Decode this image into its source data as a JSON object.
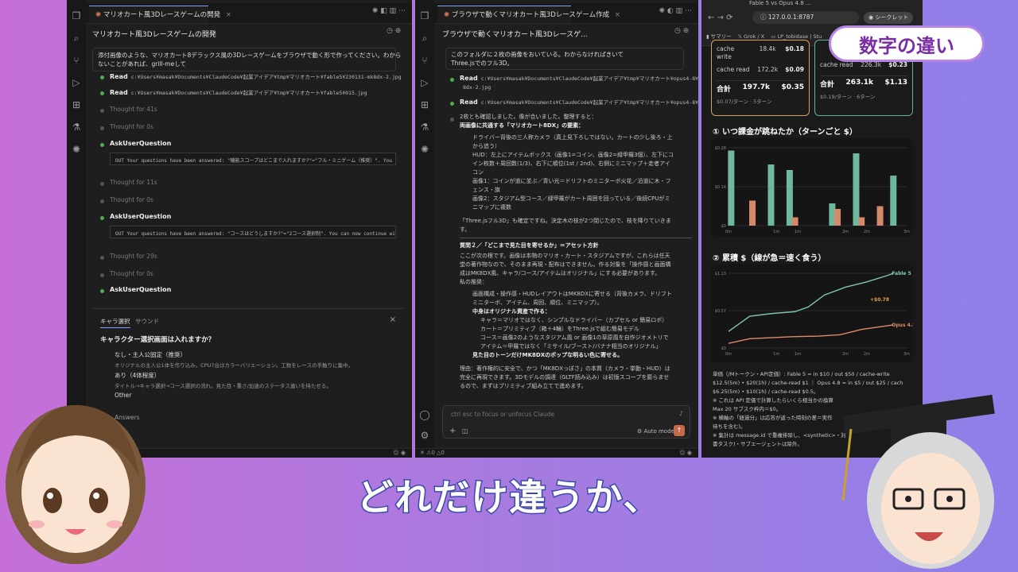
{
  "left_win": {
    "tab_title": "マリオカート風3Dレースゲームの開発",
    "header": "マリオカート風3Dレースゲームの開発",
    "prompt_line1": "添付画像のような、マリオカート8デラックス風の3Dレースゲームをブラウザで動く形で作ってください。わから",
    "prompt_line2": "ないことがあれば、grill-meして",
    "read1_label": "Read",
    "read1_path": "c:¥Users¥masak¥Documents¥ClaudeCode¥起業アイデア¥tmp¥マリオカート¥fable5¥230131-mk8dx-2.jpg",
    "read2_label": "Read",
    "read2_path": "c:¥Users¥masak¥Documents¥ClaudeCode¥起業アイデア¥tmp¥マリオカート¥fable5¥015.jpg",
    "thought1": "Thought for 41s",
    "thought2": "Thought for 0s",
    "ask1": "AskUserQuestion",
    "answer1": "OUT  Your questions have been answered: \"機能スコープはどこまで入れますか?\"=\"フル・ミニゲーム（推奨）\". You can",
    "thought3": "Thought for 11s",
    "thought4": "Thought for 0s",
    "ask2": "AskUserQuestion",
    "answer2": "OUT  Your questions have been answered: \"コースはどうしますか?\"=\"2コース選択制\". You can now continue with the",
    "thought5": "Thought for 29s",
    "thought6": "Thought for 0s",
    "ask3": "AskUserQuestion",
    "q_tab1": "キャラ選択",
    "q_tab2": "サウンド",
    "question": "キャラクター選択画面は入れますか？",
    "opt1_title": "なし・主人公固定（推奨）",
    "opt1_desc": "オリジナルの主人公1体を作り込み。CPU7台はカラーバリエーション。工数をレースの手触りに集中。",
    "opt2_title": "あり（4体程度）",
    "opt2_desc": "タイトル→キャラ選択→コース選択の流れ。見た目・重さ/加速のステータス違いを持たせる。",
    "opt3_title": "Other",
    "submit": "Answers"
  },
  "mid_win": {
    "tab_title": "ブラウザで動くマリオカート風3Dレースゲーム作成",
    "header": "ブラウザで動くマリオカート風3Dレースゲ...",
    "msg1": "このフォルダに２枚の画像をおいている。わからなければきいて",
    "msg2": "Three.jsでのフル3D。",
    "read1_label": "Read",
    "read1_path": "c:¥Users¥masak¥Documents¥ClaudeCode¥起業アイデア¥tmp¥マリオカート¥opus4-8¥230131-mk",
    "read1_path2": "8dx-2.jpg",
    "read2_label": "Read",
    "read2_path": "c:¥Users¥masak¥Documents¥ClaudeCode¥起業アイデア¥tmp¥マリオカート¥opus4-8¥015.jpg",
    "p1": "2枚とも確認しました。像が合いました。整理すると：",
    "p2": "両画像に共通する「マリオカート8DX」の要素：",
    "b1": "ドライバー背後の三人称カメラ（真上見下ろしではない。カートの少し後ろ・上",
    "b1b": "から追う）",
    "b2": "HUD：左上にアイテムボックス（画像1=コイン、画像2=緑甲羅3個）、左下にコ",
    "b2b": "イン枚数＋周回数(1/3)、右下に順位(1st / 2nd)、右側にミニマップ＋走者アイ",
    "b2c": "コン",
    "b3": "画像1：コインが道に並ぶ／青い光＝ドリフトのミニターボ火花／沿道に木・フ",
    "b3b": "ェンス・旗",
    "b4": "画像2：スタジアム型コース／緑甲羅がカート周囲を回っている／後続CPUがミ",
    "b4b": "ニマップに複数",
    "p3": "「Three.jsフル3D」も確定ですね。決定木の枝が2つ閉じたので、枝を降りていきま",
    "p3b": "す。",
    "q2": "質問２／「どこまで見た目を寄せるか」＝アセット方針",
    "p4": "ここが次の根です。画像は本物のマリオ・カート・スタジアムですが、これらは任天",
    "p4b": "堂の著作物なので、そのまま再現・配布はできません。作る対象を「操作感と画面構",
    "p4c": "成はMK8DX風、キャラ/コース/アイテムはオリジナル」にする必要があります。",
    "p5": "私の推奨：",
    "c1": "画面構成・操作感・HUDレイアウトはMK8DXに寄せる（背後カメラ、ドリフト",
    "c1b": "ミニターボ、アイテム、周回、順位、ミニマップ）。",
    "c2": "中身はオリジナル資産で作る：",
    "c3": "キャラ＝マリオではなく、シンプルなドライバー（カプセル or 簡易ロボ）",
    "c4": "カート＝プリミティブ（箱＋4輪）をThree.jsで組む簡易モデル",
    "c5": "コース＝画像2のようなスタジアム風 or 画像1の草原風を自作ジオメトリで",
    "c6": "アイテム＝甲羅ではなく「ミサイル/ブースト/バナナ相当のオリジナル」",
    "c7": "見た目のトーンだけMK8DXのポップな明るい色に寄せる。",
    "p6": "理由：著作権的に安全で、かつ「MK8DXっぽさ」の本質（カメラ・挙動・HUD）は",
    "p6b": "完全に再現できます。3Dモデルの調達（GLTF読み込み）は初版スコープを膨らませ",
    "p6c": "るので、まずはプリミティブ組み立てで進めます。",
    "input_placeholder": "ctrl esc to focus or unfocus Claude",
    "mode": "Auto mode"
  },
  "browser": {
    "tab1": "Fable 5 vs Opus 4.8 ...",
    "url": "127.0.0.1:8787",
    "profile": "シークレット",
    "bm1": "サマリー",
    "bm2": "Grok / X",
    "bm3": "LP_tobidase | Stu",
    "left_card": {
      "rows": [
        {
          "label": "cache write",
          "tok": "18.4k",
          "usd": "$0.18"
        },
        {
          "label": "cache read",
          "tok": "172.2k",
          "usd": "$0.09"
        }
      ],
      "total_label": "合計",
      "total_tok": "197.7k",
      "total_usd": "$0.35",
      "foot": "$0.07/ターン · 5ターン"
    },
    "right_card": {
      "rows": [
        {
          "label": "cache read",
          "tok": "226.3k",
          "usd": "$0.23"
        }
      ],
      "total_label": "合計",
      "total_tok": "263.1k",
      "total_usd": "$1.13",
      "foot": "$0.19/ターン · 6ターン"
    },
    "sec1": "① いつ課金が跳ねたか（ターンごと $）",
    "sec2": "② 累積 $（線が急＝速く食う）",
    "note1": "単価（/Mトークン・API定価）: Fable 5 = in $10 / out $50 / cache-write",
    "note2": "$12.5(5m) • $20(1h) / cache-read $1 ｜ Opus 4.8 = in $5 / out $25 / cach",
    "note3": "$6.25(5m) • $10(1h) / cache-read $0.5。",
    "note4": "※ これは API 定価で計算したらいくら相当かの換算",
    "note5": "Max 20 サブスク枠内＝$0。",
    "note6": "※ 横軸の「経過分」は応答が返った時刻の差＝実作",
    "note7": "待ちを含む)。",
    "note8": "※ 集計は message.id で重複排除し、<synthetic>・対",
    "note9": "書タスク)・サブエージェントは除外。"
  },
  "chart_data": [
    {
      "type": "bar",
      "title": "① いつ課金が跳ねたか（ターンごと $）",
      "x_tick_labels": [
        "0m",
        "1m",
        "1m",
        "2m",
        "2m",
        "3m"
      ],
      "y_tick_labels": [
        "$0.28",
        "$0.14",
        "$0"
      ],
      "ylim": [
        0,
        0.28
      ],
      "series": [
        {
          "color": "#6fb8a0",
          "points": [
            {
              "x": 0.05,
              "y": 0.27
            },
            {
              "x": 0.8,
              "y": 0.22
            },
            {
              "x": 1.15,
              "y": 0.2
            },
            {
              "x": 1.95,
              "y": 0.08
            },
            {
              "x": 2.4,
              "y": 0.26
            },
            {
              "x": 3.1,
              "y": 0.18
            }
          ]
        },
        {
          "color": "#d48a6a",
          "points": [
            {
              "x": 0.45,
              "y": 0.09
            },
            {
              "x": 1.25,
              "y": 0.03
            },
            {
              "x": 2.05,
              "y": 0.06
            },
            {
              "x": 2.5,
              "y": 0.03
            },
            {
              "x": 2.85,
              "y": 0.07
            }
          ]
        }
      ]
    },
    {
      "type": "line",
      "title": "② 累積 $（線が急＝速く食う）",
      "x_tick_labels": [
        "0m",
        "1m",
        "1m",
        "2m",
        "2m",
        "3m"
      ],
      "y_tick_labels": [
        "$1.13",
        "$0.57",
        "$0"
      ],
      "ylim": [
        0,
        1.13
      ],
      "annotations": [
        "+$0.78"
      ],
      "series": [
        {
          "name": "Fable 5",
          "color": "#7ec8a8",
          "points": [
            {
              "x": 0,
              "y": 0.25
            },
            {
              "x": 0.4,
              "y": 0.48
            },
            {
              "x": 0.8,
              "y": 0.52
            },
            {
              "x": 1.25,
              "y": 0.55
            },
            {
              "x": 1.5,
              "y": 0.62
            },
            {
              "x": 1.8,
              "y": 0.8
            },
            {
              "x": 2.2,
              "y": 0.92
            },
            {
              "x": 2.6,
              "y": 1.0
            },
            {
              "x": 3.0,
              "y": 1.1
            },
            {
              "x": 3.1,
              "y": 1.13
            }
          ]
        },
        {
          "name": "Opus 4.8",
          "color": "#e08a6a",
          "points": [
            {
              "x": 0,
              "y": 0.07
            },
            {
              "x": 0.4,
              "y": 0.14
            },
            {
              "x": 1.2,
              "y": 0.17
            },
            {
              "x": 1.7,
              "y": 0.18
            },
            {
              "x": 2.1,
              "y": 0.2
            },
            {
              "x": 2.5,
              "y": 0.28
            },
            {
              "x": 3.1,
              "y": 0.35
            }
          ]
        }
      ]
    }
  ],
  "overlay": {
    "badge": "数字の違い",
    "subtitle": "どれだけ違うか、"
  },
  "colors": {
    "accent_green": "#4caf50",
    "teal": "#5db3a0",
    "orange": "#e08a6a"
  }
}
